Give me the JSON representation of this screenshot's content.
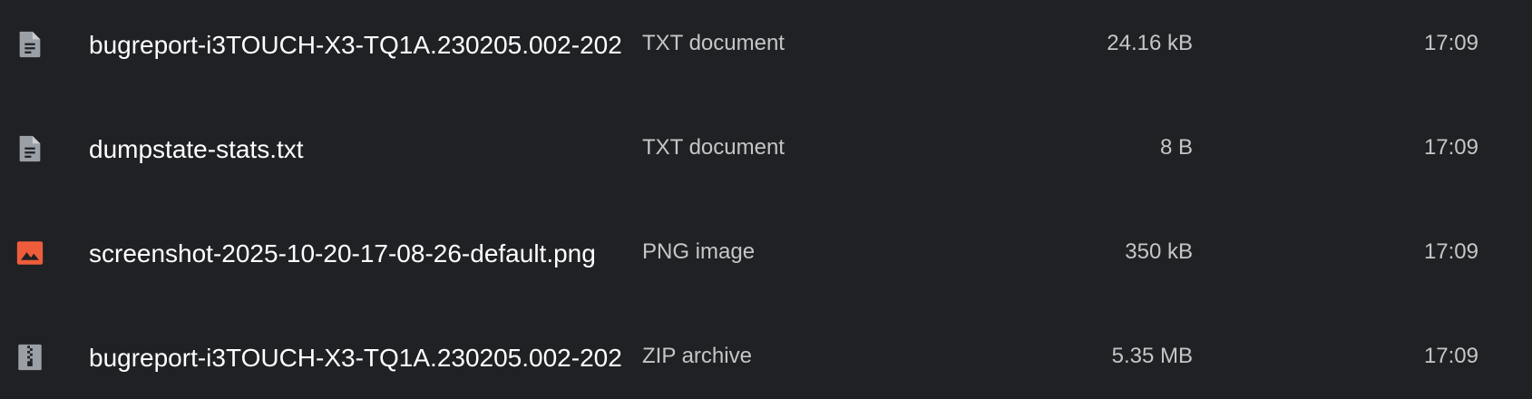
{
  "files": [
    {
      "icon": "text-document-icon",
      "name": "bugreport-i3TOUCH-X3-TQ1A.230205.002-202",
      "type": "TXT document",
      "size": "24.16 kB",
      "time": "17:09"
    },
    {
      "icon": "text-document-icon",
      "name": "dumpstate-stats.txt",
      "type": "TXT document",
      "size": "8 B",
      "time": "17:09"
    },
    {
      "icon": "image-icon",
      "name": "screenshot-2025-10-20-17-08-26-default.png",
      "type": "PNG image",
      "size": "350 kB",
      "time": "17:09"
    },
    {
      "icon": "zip-archive-icon",
      "name": "bugreport-i3TOUCH-X3-TQ1A.230205.002-202",
      "type": "ZIP archive",
      "size": "5.35 MB",
      "time": "17:09"
    }
  ],
  "colors": {
    "background": "#202124",
    "text_primary": "#ffffff",
    "text_secondary": "#c4c7c5",
    "icon_gray": "#9aa0a6",
    "icon_image": "#ee5d3b"
  }
}
